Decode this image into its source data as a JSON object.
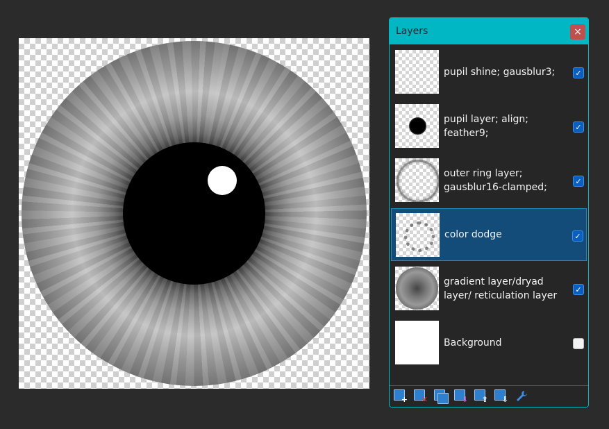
{
  "panel": {
    "title": "Layers",
    "close_label": "×"
  },
  "layers": [
    {
      "name": "pupil shine; gausblur3;",
      "visible": true,
      "selected": false
    },
    {
      "name": "pupil layer; align; feather9;",
      "visible": true,
      "selected": false
    },
    {
      "name": "outer ring layer; gausblur16-clamped;",
      "visible": true,
      "selected": false
    },
    {
      "name": "color dodge",
      "visible": true,
      "selected": true
    },
    {
      "name": "gradient layer/dryad layer/ reticulation layer",
      "visible": true,
      "selected": false
    },
    {
      "name": "Background",
      "visible": false,
      "selected": false
    }
  ],
  "toolbar": {
    "icons": [
      "add-layer-icon",
      "delete-layer-icon",
      "duplicate-layer-icon",
      "merge-down-icon",
      "move-layer-up-icon",
      "move-layer-down-icon",
      "layer-properties-icon"
    ]
  },
  "colors": {
    "accent": "#00b7c3",
    "selected": "#134b79",
    "checkbox": "#0a5fbf",
    "close": "#c0504d",
    "background": "#2b2b2b"
  }
}
